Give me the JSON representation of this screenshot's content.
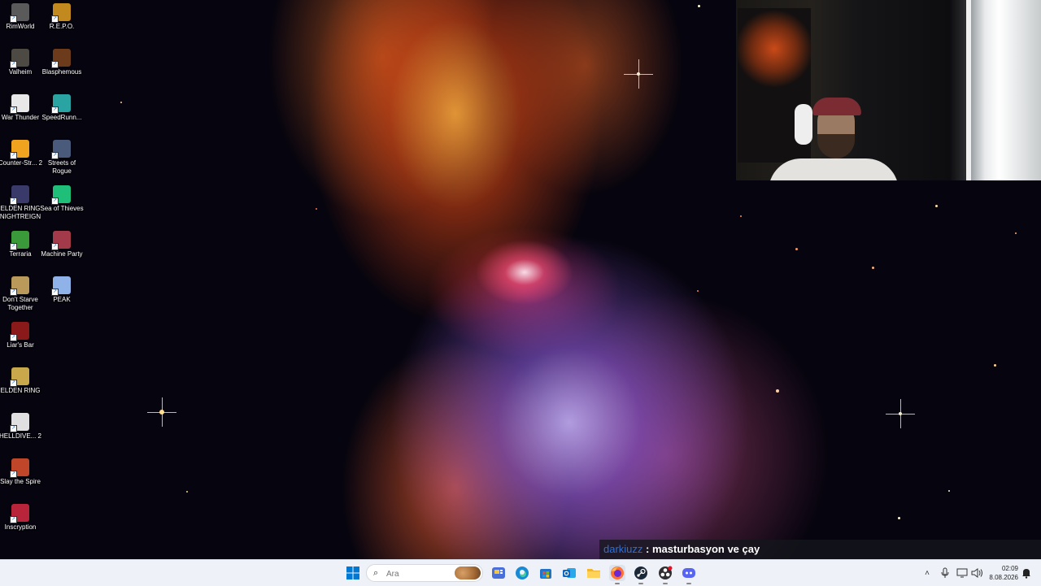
{
  "desktop": {
    "icons": [
      {
        "label": "RimWorld",
        "icon": "rimworld-icon",
        "color": "#5a5a5a"
      },
      {
        "label": "R.E.P.O.",
        "icon": "repo-icon",
        "color": "#c28a1e"
      },
      {
        "label": "Valheim",
        "icon": "valheim-icon",
        "color": "#4d4a44"
      },
      {
        "label": "Blasphemous",
        "icon": "blasphemous-icon",
        "color": "#6b3b1c"
      },
      {
        "label": "War Thunder",
        "icon": "war-thunder-icon",
        "color": "#e8e8e8"
      },
      {
        "label": "SpeedRunn...",
        "icon": "speedrunners-icon",
        "color": "#2aa3a3"
      },
      {
        "label": "Counter-Str... 2",
        "icon": "counter-strike-icon",
        "color": "#f0a31f"
      },
      {
        "label": "Streets of Rogue",
        "icon": "streets-of-rogue-icon",
        "color": "#4a5a7a"
      },
      {
        "label": "ELDEN RING NIGHTREIGN",
        "icon": "elden-ring-nightreign-icon",
        "color": "#3a3a6a"
      },
      {
        "label": "Sea of Thieves",
        "icon": "sea-of-thieves-icon",
        "color": "#1fbf7a"
      },
      {
        "label": "Terraria",
        "icon": "terraria-icon",
        "color": "#3a9a3a"
      },
      {
        "label": "Machine Party",
        "icon": "machine-party-icon",
        "color": "#a33a4a"
      },
      {
        "label": "Don't Starve Together",
        "icon": "dont-starve-together-icon",
        "color": "#b99a5a"
      },
      {
        "label": "PEAK",
        "icon": "peak-icon",
        "color": "#8fb2e8"
      },
      {
        "label": "Liar's Bar",
        "icon": "liars-bar-icon",
        "color": "#8a1a1a"
      },
      {
        "label": "ELDEN RING",
        "icon": "elden-ring-icon",
        "color": "#c8a84a"
      },
      {
        "label": "HELLDIVE... 2",
        "icon": "helldivers-icon",
        "color": "#e0e0e0"
      },
      {
        "label": "Slay the Spire",
        "icon": "slay-the-spire-icon",
        "color": "#c0462a"
      },
      {
        "label": "Inscryption",
        "icon": "inscryption-icon",
        "color": "#b8243a"
      }
    ]
  },
  "chat": {
    "user": "darkiuzz",
    "separator": " : ",
    "message": "masturbasyon ve çay",
    "user_color": "#2f6fd6"
  },
  "taskbar": {
    "search_placeholder": "Ara",
    "apps": [
      {
        "name": "start-button",
        "icon": "windows-logo-icon"
      },
      {
        "name": "taskbar-news",
        "icon": "news-icon"
      },
      {
        "name": "taskbar-edge",
        "icon": "edge-icon"
      },
      {
        "name": "taskbar-store",
        "icon": "store-icon"
      },
      {
        "name": "taskbar-outlook",
        "icon": "outlook-icon"
      },
      {
        "name": "taskbar-explorer",
        "icon": "folder-icon"
      },
      {
        "name": "taskbar-firefox",
        "icon": "firefox-icon"
      },
      {
        "name": "taskbar-steam",
        "icon": "steam-icon"
      },
      {
        "name": "taskbar-obs",
        "icon": "obs-icon"
      },
      {
        "name": "taskbar-discord",
        "icon": "discord-icon"
      }
    ],
    "time": "02:09",
    "date": "8.08.2026",
    "accent": "#0067c0"
  }
}
